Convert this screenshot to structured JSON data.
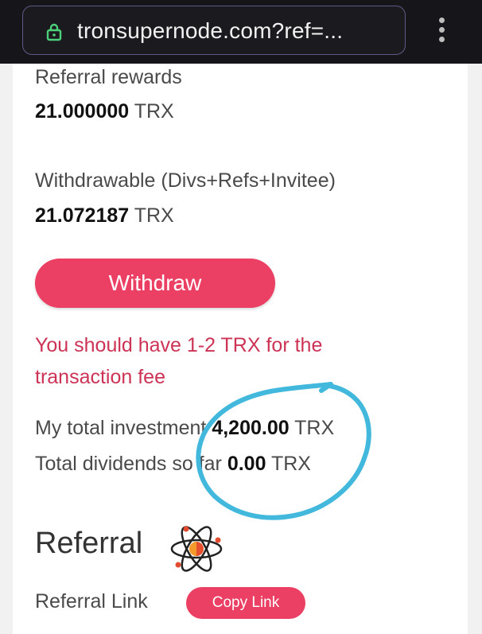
{
  "browser": {
    "url": "tronsupernode.com?ref=..."
  },
  "stats": {
    "referral_rewards_label": "Referral rewards",
    "referral_rewards_value": "21.000000",
    "withdrawable_label": "Withdrawable (Divs+Refs+Invitee)",
    "withdrawable_value": "21.072187",
    "currency": "TRX"
  },
  "withdraw": {
    "button_label": "Withdraw",
    "fee_warning": "You should have 1-2 TRX for the transaction fee"
  },
  "investment": {
    "label": "My total investment",
    "value": "4,200.00",
    "currency": "TRX"
  },
  "dividends": {
    "label": "Total dividends so far",
    "value": "0.00",
    "currency": "TRX"
  },
  "referral": {
    "title": "Referral",
    "link_label": "Referral Link",
    "copy_button": "Copy Link"
  },
  "colors": {
    "accent": "#eb3f63",
    "annotation": "#41b8dc",
    "topbar": "#16161a"
  }
}
